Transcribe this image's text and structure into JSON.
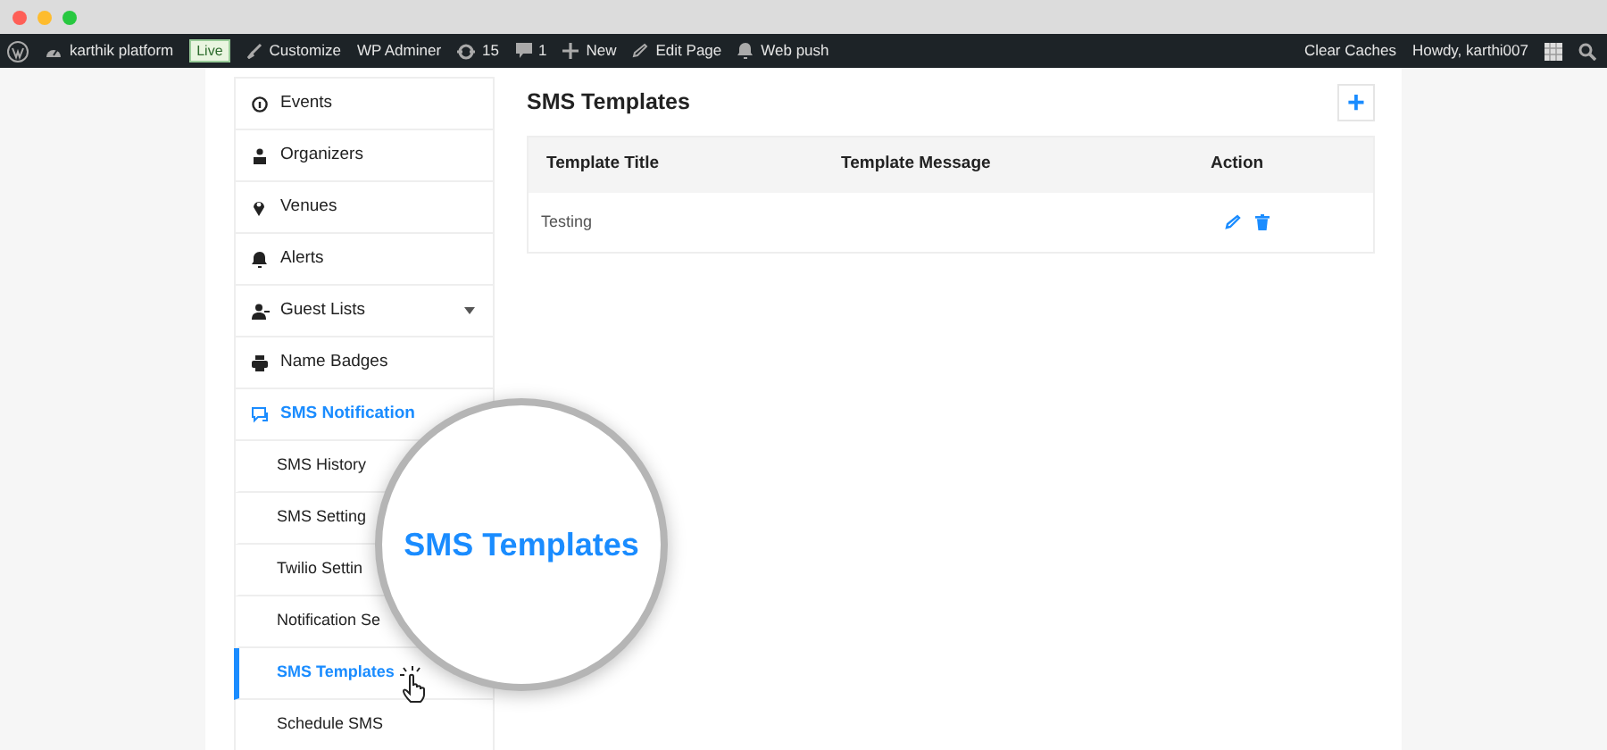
{
  "admin_bar": {
    "left": [
      {
        "kind": "logo"
      },
      {
        "kind": "site",
        "label": "karthik platform"
      },
      {
        "kind": "badge",
        "label": "Live"
      },
      {
        "kind": "brush",
        "label": "Customize"
      },
      {
        "kind": "text",
        "label": "WP Adminer"
      },
      {
        "kind": "updates",
        "label": "15"
      },
      {
        "kind": "comments",
        "label": "1"
      },
      {
        "kind": "new",
        "label": "New"
      },
      {
        "kind": "edit",
        "label": "Edit Page"
      },
      {
        "kind": "bell",
        "label": "Web push"
      }
    ],
    "right": [
      {
        "kind": "text",
        "label": "Clear Caches"
      },
      {
        "kind": "text",
        "label": "Howdy, karthi007"
      },
      {
        "kind": "avatar"
      },
      {
        "kind": "search"
      }
    ]
  },
  "sidebar": {
    "items": [
      {
        "label": "Events",
        "selected": false,
        "caret": false
      },
      {
        "label": "Organizers",
        "selected": false,
        "caret": false
      },
      {
        "label": "Venues",
        "selected": false,
        "caret": false
      },
      {
        "label": "Alerts",
        "selected": false,
        "caret": false
      },
      {
        "label": "Guest Lists",
        "selected": false,
        "caret": true
      },
      {
        "label": "Name Badges",
        "selected": false,
        "caret": false
      },
      {
        "label": "SMS Notification",
        "selected": true,
        "caret": false,
        "children": [
          {
            "label": "SMS History",
            "selected": false
          },
          {
            "label": "SMS Setting",
            "selected": false
          },
          {
            "label": "Twilio Settin",
            "selected": false
          },
          {
            "label": "Notification Se",
            "selected": false
          },
          {
            "label": "SMS Templates",
            "selected": true
          },
          {
            "label": "Schedule SMS",
            "selected": false
          }
        ]
      }
    ]
  },
  "main": {
    "title": "SMS Templates",
    "add_button": "+",
    "table": {
      "columns": [
        "Template Title",
        "Template Message",
        "Action"
      ],
      "rows": [
        {
          "title": "Testing",
          "message": ""
        }
      ]
    }
  },
  "magnifier": {
    "text": "SMS Templates"
  }
}
